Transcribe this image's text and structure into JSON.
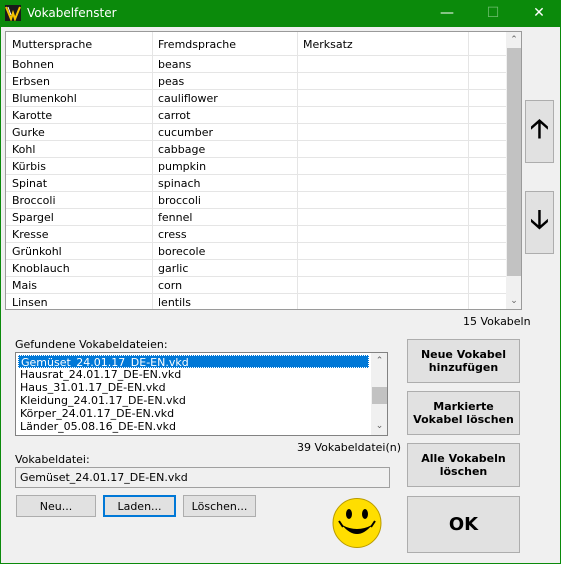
{
  "window": {
    "title": "Vokabelfenster",
    "minimize": "—",
    "maximize": "☐",
    "close": "✕"
  },
  "table": {
    "headers": [
      "Muttersprache",
      "Fremdsprache",
      "Merksatz"
    ],
    "rows": [
      [
        "Bohnen",
        "beans",
        ""
      ],
      [
        "Erbsen",
        "peas",
        ""
      ],
      [
        "Blumenkohl",
        "cauliflower",
        ""
      ],
      [
        "Karotte",
        "carrot",
        ""
      ],
      [
        "Gurke",
        "cucumber",
        ""
      ],
      [
        "Kohl",
        "cabbage",
        ""
      ],
      [
        "Kürbis",
        "pumpkin",
        ""
      ],
      [
        "Spinat",
        "spinach",
        ""
      ],
      [
        "Broccoli",
        "broccoli",
        ""
      ],
      [
        "Spargel",
        "fennel",
        ""
      ],
      [
        "Kresse",
        "cress",
        ""
      ],
      [
        "Grünkohl",
        "borecole",
        ""
      ],
      [
        "Knoblauch",
        "garlic",
        ""
      ],
      [
        "Mais",
        "corn",
        ""
      ],
      [
        "Linsen",
        "lentils",
        ""
      ]
    ],
    "count": "15 Vokabeln"
  },
  "move": {
    "up_icon": "arrow-up",
    "down_icon": "arrow-down",
    "up_glyph": "🡡",
    "down_glyph": "🡣"
  },
  "files": {
    "label": "Gefundene Vokabeldateien:",
    "items": [
      "Gemüset_24.01.17_DE-EN.vkd",
      "Hausrat_24.01.17_DE-EN.vkd",
      "Haus_31.01.17_DE-EN.vkd",
      "Kleidung_24.01.17_DE-EN.vkd",
      "Körper_24.01.17_DE-EN.vkd",
      "Länder_05.08.16_DE-EN.vkd"
    ],
    "selected_index": 0,
    "count": "39 Vokabeldatei(n)"
  },
  "file": {
    "label": "Vokabeldatei:",
    "value": "Gemüset_24.01.17_DE-EN.vkd"
  },
  "buttons": {
    "new": "Neu...",
    "load": "Laden...",
    "delete": "Löschen...",
    "add_vocab": "Neue Vokabel hinzufügen",
    "delete_marked": "Markierte Vokabel löschen",
    "delete_all": "Alle Vokabeln löschen",
    "ok": "OK"
  },
  "colors": {
    "titlebar": "#0b8a0b",
    "selection": "#0078d7",
    "smiley": "#ffde00"
  }
}
